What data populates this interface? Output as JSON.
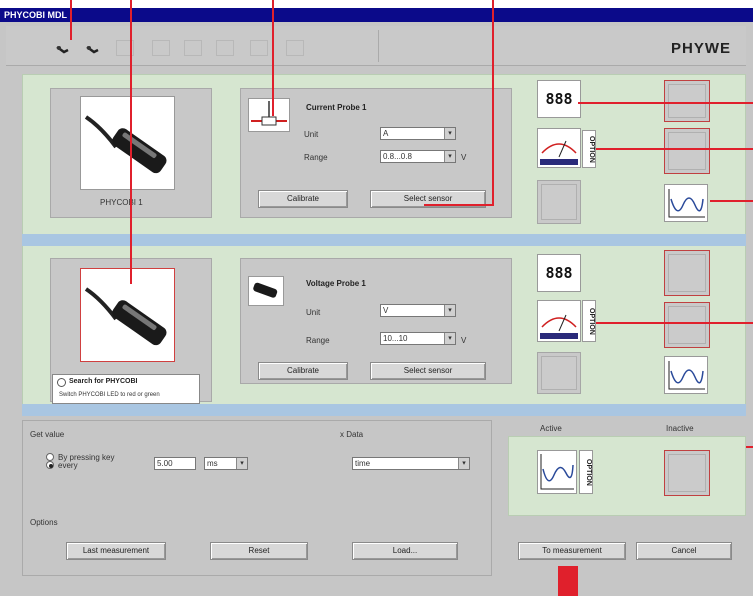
{
  "window": {
    "title": "PHYCOBI MDL",
    "brand": "PHYWE"
  },
  "probes": [
    {
      "device_label": "PHYCOBI 1",
      "name": "Current Probe 1",
      "unit_label": "Unit",
      "unit_value": "A",
      "range_label": "Range",
      "range_value": "0.8...0.8",
      "range_unit": "V",
      "calibrate": "Calibrate",
      "select_sensor": "Select sensor"
    },
    {
      "device_label": "",
      "name": "Voltage Probe 1",
      "unit_label": "Unit",
      "unit_value": "V",
      "range_label": "Range",
      "range_value": "10...10",
      "range_unit": "V",
      "calibrate": "Calibrate",
      "select_sensor": "Select sensor"
    }
  ],
  "displays": {
    "digital": "888",
    "option": "OPTION"
  },
  "tooltip": {
    "title": "Search for PHYCOBI",
    "text": "Switch PHYCOBI LED to red or green"
  },
  "get_value": {
    "title": "Get value",
    "option_keypress": "By pressing key",
    "option_every": "every",
    "interval_value": "5.00",
    "interval_unit": "ms",
    "x_data_label": "x Data",
    "x_data_value": "time"
  },
  "options": {
    "title": "Options",
    "last_measurement": "Last measurement",
    "reset": "Reset",
    "load": "Load..."
  },
  "active_label": "Active",
  "inactive_label": "Inactive",
  "buttons": {
    "to_measurement": "To measurement",
    "cancel": "Cancel"
  },
  "colors": {
    "title_bar": "#0b0a8a",
    "panel_green": "#d6e6d0",
    "separator_blue": "#a9c6e2",
    "annotation_red": "#e0202c"
  }
}
